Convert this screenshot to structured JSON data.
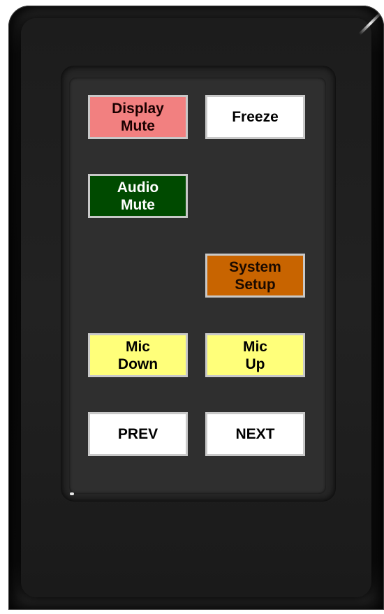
{
  "panel": {
    "buttons": {
      "display_mute": {
        "label": "Display\nMute",
        "bg": "#f28080",
        "fg": "#1a0000"
      },
      "freeze": {
        "label": "Freeze",
        "bg": "#ffffff",
        "fg": "#000000"
      },
      "audio_mute": {
        "label": "Audio\nMute",
        "bg": "#004a00",
        "fg": "#ffffff"
      },
      "system_setup": {
        "label": "System\nSetup",
        "bg": "#c86400",
        "fg": "#1a0a00"
      },
      "mic_down": {
        "label": "Mic\nDown",
        "bg": "#ffff7a",
        "fg": "#000000"
      },
      "mic_up": {
        "label": "Mic\nUp",
        "bg": "#ffff7a",
        "fg": "#000000"
      },
      "prev": {
        "label": "PREV",
        "bg": "#ffffff",
        "fg": "#000000"
      },
      "next": {
        "label": "NEXT",
        "bg": "#ffffff",
        "fg": "#000000"
      }
    }
  }
}
